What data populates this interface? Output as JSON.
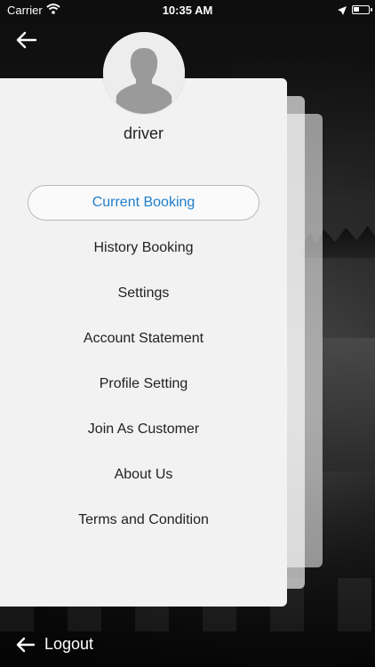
{
  "status_bar": {
    "carrier": "Carrier",
    "time": "10:35 AM"
  },
  "profile": {
    "username": "driver"
  },
  "menu": {
    "items": [
      {
        "label": "Current Booking",
        "active": true
      },
      {
        "label": "History Booking",
        "active": false
      },
      {
        "label": "Settings",
        "active": false
      },
      {
        "label": "Account Statement",
        "active": false
      },
      {
        "label": "Profile Setting",
        "active": false
      },
      {
        "label": "Join As Customer",
        "active": false
      },
      {
        "label": "About Us",
        "active": false
      },
      {
        "label": "Terms and Condition",
        "active": false
      }
    ]
  },
  "footer": {
    "logout_label": "Logout"
  },
  "icons": {
    "back": "arrow-left-icon",
    "logout": "arrow-left-icon",
    "wifi": "wifi-icon",
    "location": "location-arrow-icon",
    "battery": "battery-icon",
    "avatar": "person-silhouette-icon"
  },
  "colors": {
    "active_text": "#1f7ecb",
    "card_bg": "#f3f2f3"
  }
}
